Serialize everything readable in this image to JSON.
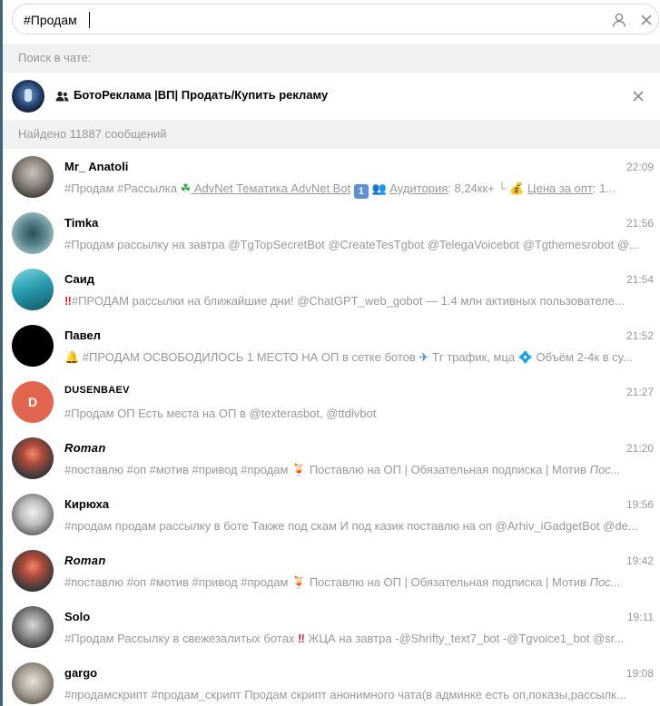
{
  "search": {
    "value": "#Продам"
  },
  "search_in_chat_label": "Поиск в чате:",
  "chat": {
    "title": "БотоРеклама |ВП| Продать/Купить рекламу"
  },
  "found_label": "Найдено 11887 сообщений",
  "results": [
    {
      "name": "Mr_ Anatoli",
      "time": "22:09",
      "p1": "#Продам #Рассылка ",
      "p2": "☘",
      "p3": " AdvNet",
      "p4": "  Тематика AdvNet Bot",
      "p5": "1",
      "p6": " 👥 ",
      "p7": "Аудитория",
      "p8": ": 8,24кк+  └ ",
      "p9": "💰 ",
      "p10": "Цена за опт",
      "p11": ": 1..."
    },
    {
      "name": "Timka",
      "time": "21:56",
      "preview": "#Продам рассылку на завтра   @TgTopSecretBot  @CreateTesTgbot  @TelegaVoicebot  @Tgthemesrobot  @..."
    },
    {
      "name": "Саид",
      "time": "21:54",
      "e1": "‼",
      "preview": "#ПРОДАМ рассылки на ближайшие дни!   @ChatGPT_web_gobot  — 1.4 млн активных пользователе..."
    },
    {
      "name": "Павел",
      "time": "21:52",
      "e1": "🔔",
      "p1": " #ПРОДАМ   ОСВОБОДИЛОСЬ 1 МЕСТО НА ОП в сетке ботов ",
      "e2": "✈",
      "p2": " Тг трафик, мца ",
      "e3": "💠",
      "p3": " Объём 2-4к в су..."
    },
    {
      "name": "DUSENBAEV",
      "time": "21:27",
      "avatar_letter": "D",
      "preview": "#Продам ОП  Есть места на ОП в @texterasbot, @ttdlvbot"
    },
    {
      "name": "Roman",
      "time": "21:20",
      "p1": "#поставлю #оп #мотив #привод #продам  ",
      "e1": "🍹",
      "p2": " Поставлю на ОП | Обязательная подписка | Мотив  ",
      "p3": "Пос..."
    },
    {
      "name": "Кирюха",
      "time": "19:56",
      "preview": "#продам  продам рассылку в боте Также под скам И под казик поставлю на оп @Arhiv_iGadgetBot @de..."
    },
    {
      "name": "Roman",
      "time": "19:42",
      "p1": "#поставлю #оп #мотив #привод #продам  ",
      "e1": "🍹",
      "p2": " Поставлю на ОП | Обязательная подписка | Мотив  ",
      "p3": "Пос..."
    },
    {
      "name": "Solo",
      "time": "19:11",
      "p1": "#Продам Рассылку в свежезалитых ботах ",
      "e1": "‼",
      "p2": " ЖЦА на завтра    -@Shrifty_text7_bot -@Tgvoice1_bot   @sr..."
    },
    {
      "name": "gargo",
      "time": "19:08",
      "preview": "#продамскрипт #продам_скрипт  Продам скрипт анонимного чата(в админке есть оп,показы,рассылк..."
    }
  ],
  "colors": {
    "accent": "#40637a",
    "muted_text": "#999999",
    "section_bg": "#f1f1f1",
    "dusenbaev_avatar": "#e2664f"
  }
}
